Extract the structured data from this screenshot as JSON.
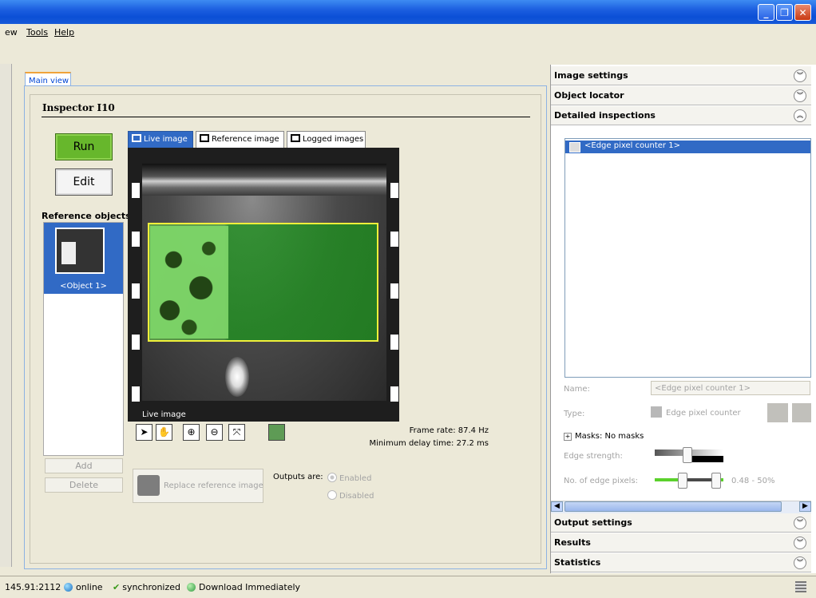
{
  "menu": [
    "ew",
    "Tools",
    "Help"
  ],
  "window_controls": {
    "minimize": "_",
    "restore": "❐",
    "close": "✕"
  },
  "main_tab": "Main view",
  "inspector_title": "Inspector I10",
  "buttons": {
    "run": "Run",
    "edit": "Edit",
    "add": "Add",
    "delete": "Delete",
    "replace_reference": "Replace reference image"
  },
  "reference_objects": {
    "label": "Reference objects",
    "items": [
      "<Object 1>"
    ]
  },
  "image_tabs": [
    "Live image",
    "Reference image",
    "Logged images"
  ],
  "viewer_caption": "Live image",
  "view_tools": [
    "pointer-icon",
    "hand-icon",
    "zoom-in-icon",
    "zoom-out-icon",
    "zoom-fit-icon",
    "display-options-icon"
  ],
  "frame_info": {
    "frame_rate": "Frame rate: 87.4 Hz",
    "min_delay": "Minimum delay time: 27.2 ms"
  },
  "outputs": {
    "label": "Outputs are:",
    "options": [
      "Enabled",
      "Disabled"
    ],
    "selected": "Enabled"
  },
  "right_panel": {
    "sections_top": [
      "Image settings",
      "Object locator",
      "Detailed inspections"
    ],
    "inspections": [
      "<Edge pixel counter 1>"
    ],
    "props": {
      "name_label": "Name:",
      "name_value": "<Edge pixel counter 1>",
      "type_label": "Type:",
      "type_value": "Edge pixel counter",
      "masks": "Masks: No masks",
      "edge_strength_label": "Edge strength:",
      "edge_pixels_label": "No. of edge pixels:",
      "edge_pixels_range": "0.48 - 50%"
    },
    "sections_bottom": [
      "Output settings",
      "Results",
      "Statistics"
    ]
  },
  "status_bar": {
    "address": "145.91:2112",
    "online": "online",
    "sync": "synchronized",
    "download": "Download Immediately"
  },
  "colors": {
    "run_green": "#67b72c",
    "selection_blue": "#316ac5",
    "roi_yellow": "#f0f03a",
    "titlebar_blue": "#1c5fe0"
  }
}
